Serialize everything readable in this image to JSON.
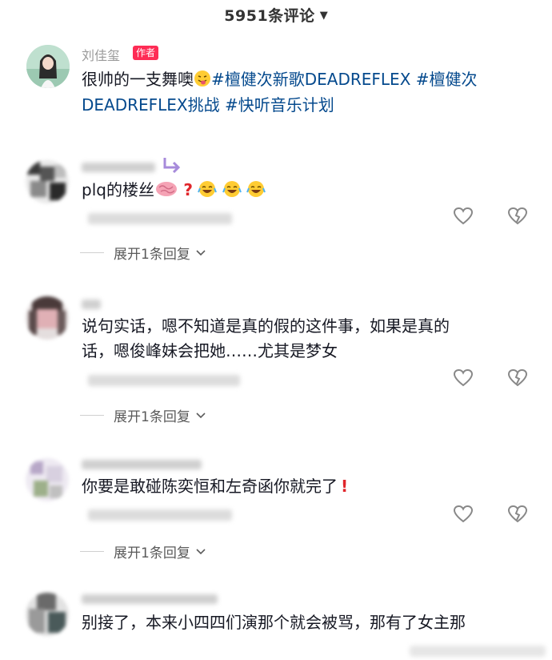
{
  "header": {
    "title": "5951条评论",
    "caret": "▼"
  },
  "author_comment": {
    "username": "刘佳玺",
    "badge": "作者",
    "line1_prefix": "很帅的一支舞噢",
    "line1_tags": "#檀健次新歌DEADREFLEX #檀健次",
    "line2_tags": "DEADREFLEX挑战 #快听音乐计划"
  },
  "comments": [
    {
      "text": "plq的楼丝",
      "question_mark": "?",
      "expand": "展开1条回复"
    },
    {
      "line1": "说句实话，嗯不知道是真的假的这件事，如果是真的",
      "line2": "话，嗯俊峰妹会把她……尤其是梦女",
      "expand": "展开1条回复"
    },
    {
      "text": "你要是敢碰陈奕恒和左奇函你就完了",
      "exclaim": "!",
      "expand": "展开1条回复"
    },
    {
      "line1": "别接了，本来小四四们演那个就会被骂，那有了女主那"
    }
  ],
  "icons": {
    "like": "heart-outline-icon",
    "dislike": "broken-heart-icon",
    "expand": "chevron-down-icon",
    "emoji_tongue": "tongue-out-emoji",
    "emoji_brain": "brain-emoji",
    "emoji_laugh": "rofl-emoji"
  },
  "colors": {
    "tag": "#04498d",
    "badge": "#fe2c55",
    "text": "#161823",
    "muted": "#9a9a9a"
  }
}
